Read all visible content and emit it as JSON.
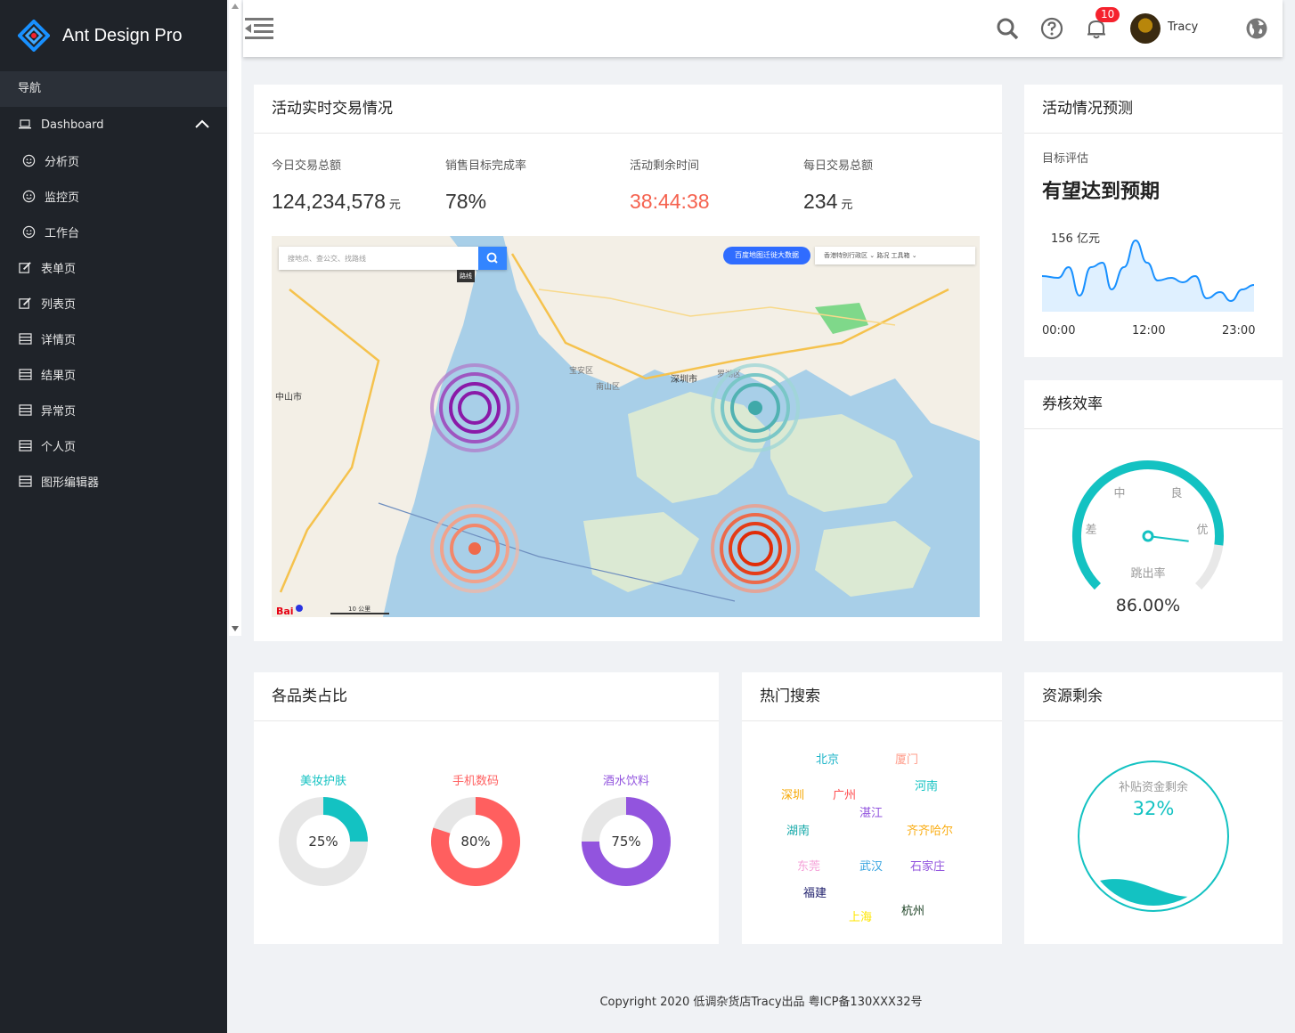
{
  "app": {
    "name": "Ant Design Pro"
  },
  "sidebar": {
    "section": "导航",
    "items": [
      {
        "label": "Dashboard",
        "icon": "laptop-icon"
      },
      {
        "label": "分析页",
        "icon": "smile-icon"
      },
      {
        "label": "监控页",
        "icon": "smile-icon"
      },
      {
        "label": "工作台",
        "icon": "smile-icon"
      },
      {
        "label": "表单页",
        "icon": "edit-icon"
      },
      {
        "label": "列表页",
        "icon": "edit-icon"
      },
      {
        "label": "详情页",
        "icon": "table-icon"
      },
      {
        "label": "结果页",
        "icon": "table-icon"
      },
      {
        "label": "异常页",
        "icon": "table-icon"
      },
      {
        "label": "个人页",
        "icon": "table-icon"
      },
      {
        "label": "图形编辑器",
        "icon": "table-icon"
      }
    ]
  },
  "header": {
    "notification_count": "10",
    "user": "Tracy"
  },
  "realtime": {
    "title": "活动实时交易情况",
    "stats": [
      {
        "label": "今日交易总额",
        "value": "124,234,578",
        "unit": "元"
      },
      {
        "label": "销售目标完成率",
        "value": "78%",
        "unit": ""
      },
      {
        "label": "活动剩余时间",
        "value": "38:44:38",
        "unit": ""
      },
      {
        "label": "每日交易总额",
        "value": "234",
        "unit": "元"
      }
    ],
    "map": {
      "search_placeholder": "搜地点、查公交、找路线",
      "route_label": "路线",
      "chip": "百度地图迁徙大数据",
      "tools": "香港特别行政区 ⌄   路况   工具箱 ⌄",
      "scale": "10 公里",
      "places": [
        "深圳市",
        "中山市",
        "南山区",
        "宝安区",
        "罗湖区"
      ]
    }
  },
  "forecast": {
    "title": "活动情况预测",
    "sub": "目标评估",
    "headline": "有望达到预期",
    "peak_label": "156 亿元",
    "x_ticks": [
      "00:00",
      "12:00",
      "23:00"
    ]
  },
  "efficiency": {
    "title": "券核效率",
    "gauge_labels": [
      "差",
      "中",
      "良",
      "优"
    ],
    "gauge_caption": "跳出率",
    "value": "86.00%",
    "ratio": 0.86
  },
  "categories": {
    "title": "各品类占比",
    "items": [
      {
        "name": "美妆护肤",
        "percent": "25%",
        "ratio": 0.25,
        "color": "#13c2c2"
      },
      {
        "name": "手机数码",
        "percent": "80%",
        "ratio": 0.8,
        "color": "#ff5f5f"
      },
      {
        "name": "酒水饮料",
        "percent": "75%",
        "ratio": 0.75,
        "color": "#9254de"
      }
    ]
  },
  "hot_search": {
    "title": "热门搜索",
    "words": [
      {
        "text": "北京",
        "color": "#1fb5c9"
      },
      {
        "text": "厦门",
        "color": "#ff9c8a"
      },
      {
        "text": "深圳",
        "color": "#f6a700"
      },
      {
        "text": "广州",
        "color": "#ff4d4f"
      },
      {
        "text": "河南",
        "color": "#13c2c2"
      },
      {
        "text": "湛江",
        "color": "#9254de"
      },
      {
        "text": "湖南",
        "color": "#13a8a8"
      },
      {
        "text": "齐齐哈尔",
        "color": "#faad14"
      },
      {
        "text": "东莞",
        "color": "#f5a0d8"
      },
      {
        "text": "武汉",
        "color": "#36a3e0"
      },
      {
        "text": "石家庄",
        "color": "#9254de"
      },
      {
        "text": "福建",
        "color": "#1d1d6b"
      },
      {
        "text": "上海",
        "color": "#ffe600"
      },
      {
        "text": "杭州",
        "color": "#173d1f"
      }
    ]
  },
  "resource": {
    "title": "资源剩余",
    "caption": "补贴资金剩余",
    "value": "32%",
    "ratio": 0.32
  },
  "footer": "Copyright  2020 低调杂货店Tracy出品 粤ICP备130XXX32号"
}
